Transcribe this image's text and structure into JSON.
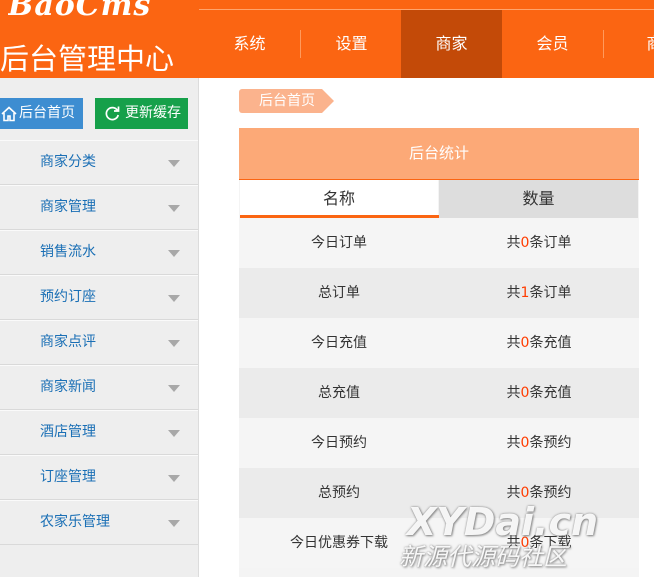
{
  "header": {
    "logo": "BaoCms",
    "title": "后台管理中心",
    "nav": [
      {
        "label": "系统"
      },
      {
        "label": "设置"
      },
      {
        "label": "商家",
        "active": true
      },
      {
        "label": "会员"
      },
      {
        "label": "商"
      }
    ]
  },
  "sidebar": {
    "home_button": {
      "label": "后台首页",
      "icon": "home-icon"
    },
    "cache_button": {
      "label": "更新缓存",
      "icon": "refresh-icon"
    },
    "menu": [
      {
        "label": "商家分类"
      },
      {
        "label": "商家管理"
      },
      {
        "label": "销售流水"
      },
      {
        "label": "预约订座"
      },
      {
        "label": "商家点评"
      },
      {
        "label": "商家新闻"
      },
      {
        "label": "酒店管理"
      },
      {
        "label": "订座管理"
      },
      {
        "label": "农家乐管理"
      }
    ]
  },
  "breadcrumb": {
    "label": "后台首页"
  },
  "stats": {
    "title": "后台统计",
    "columns": {
      "name": "名称",
      "count": "数量"
    },
    "rows": [
      {
        "name": "今日订单",
        "prefix": "共",
        "value": "0",
        "suffix": "条订单"
      },
      {
        "name": "总订单",
        "prefix": "共",
        "value": "1",
        "suffix": "条订单"
      },
      {
        "name": "今日充值",
        "prefix": "共",
        "value": "0",
        "suffix": "条充值"
      },
      {
        "name": "总充值",
        "prefix": "共",
        "value": "0",
        "suffix": "条充值"
      },
      {
        "name": "今日预约",
        "prefix": "共",
        "value": "0",
        "suffix": "条预约"
      },
      {
        "name": "总预约",
        "prefix": "共",
        "value": "0",
        "suffix": "条预约"
      },
      {
        "name": "今日优惠券下载",
        "prefix": "共",
        "value": "0",
        "suffix": "条下载"
      }
    ]
  },
  "watermark": {
    "line1": "XYDai.cn",
    "line2": "新源代源码社区"
  },
  "colors": {
    "brand_orange": "#fb6512",
    "nav_active": "#c34a08",
    "home_button": "#3d8dd1",
    "cache_button": "#16a04a",
    "menu_text": "#1a6fb5",
    "highlight_number": "#ff3c00"
  }
}
